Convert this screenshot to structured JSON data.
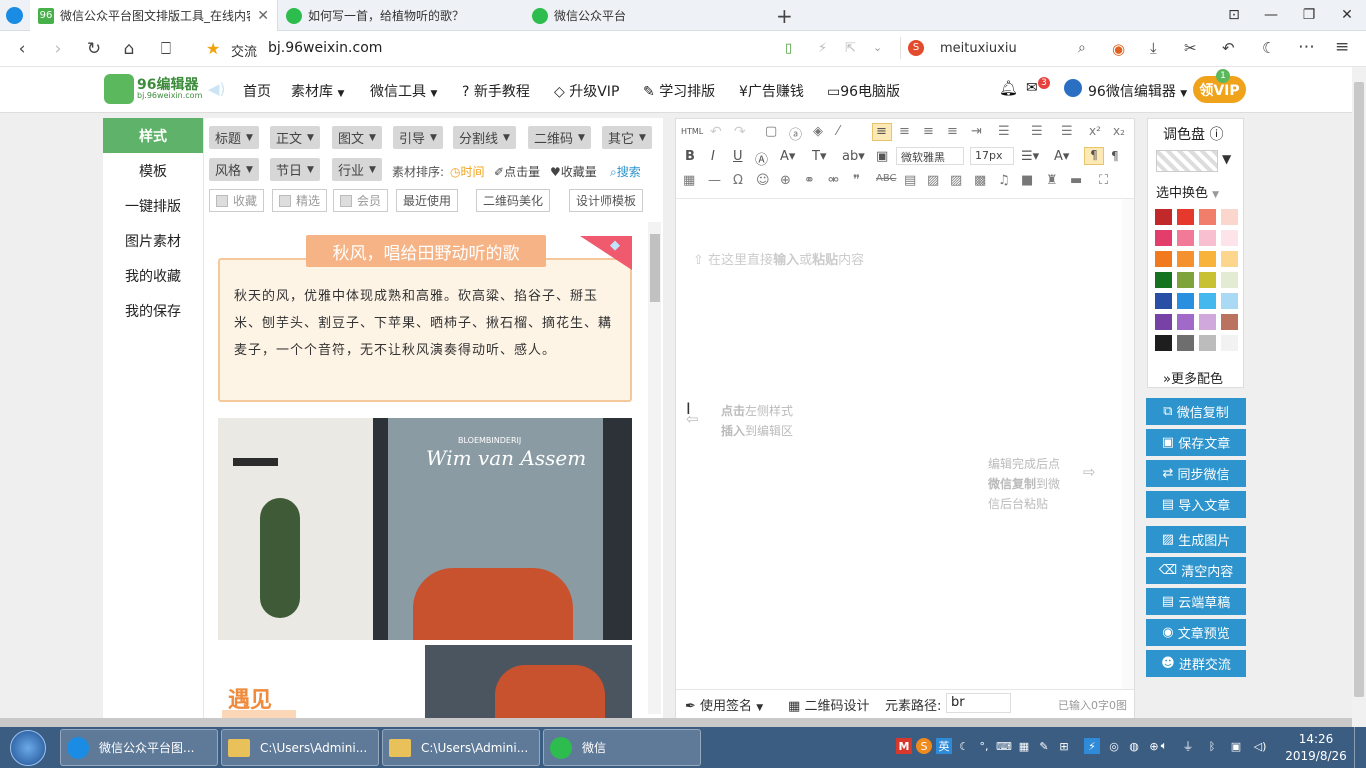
{
  "browser": {
    "tabs": [
      {
        "badge": "96",
        "title": "微信公众平台图文排版工具_在线内容"
      },
      {
        "title": "如何写一首，给植物听的歌？"
      },
      {
        "title": "微信公众平台"
      }
    ],
    "new_tab": "+",
    "bookmark_label": "交流",
    "url": "bj.96weixin.com",
    "search_value": "meituxiuxiu"
  },
  "site": {
    "logo_title": "96编辑器",
    "logo_sub": "bj.96weixin.com",
    "nav": [
      "首页",
      "素材库",
      "微信工具",
      "新手教程",
      "升级VIP",
      "学习排版",
      "广告赚钱",
      "96电脑版"
    ],
    "mail_count": "3",
    "account": "96微信编辑器",
    "vip_button": "领VIP",
    "vip_corner": "1"
  },
  "left_menu": [
    "样式",
    "模板",
    "一键排版",
    "图片素材",
    "我的收藏",
    "我的保存"
  ],
  "filters": {
    "row1": [
      "标题",
      "正文",
      "图文",
      "引导",
      "分割线",
      "二维码",
      "其它"
    ],
    "row2": [
      "风格",
      "节日",
      "行业"
    ],
    "sort_label": "素材排序:",
    "sort_options": [
      "时间",
      "点击量",
      "收藏量"
    ],
    "search": "搜索",
    "checks": [
      "收藏",
      "精选",
      "会员"
    ],
    "buttons": [
      "最近使用",
      "二维码美化",
      "设计师模板"
    ]
  },
  "preview": {
    "title": "秋风，唱给田野动听的歌",
    "body": "秋天的风，优雅中体现成熟和高雅。砍高粱、掐谷子、掰玉米、刨芋头、割豆子、下苹果、晒柿子、揪石榴、摘花生、耩麦子，一个个音符，无不让秋风演奏得动听、感人。",
    "shop_sign": "Wim van Assem",
    "shop_sign_small": "BLOEMBINDERIJ",
    "heading": "遇见"
  },
  "editor": {
    "html_label": "HTML",
    "font": "微软雅黑",
    "size": "17px",
    "hint_prefix": "在这里直接",
    "hint_bold1": "输入",
    "hint_mid": "或",
    "hint_bold2": "粘贴",
    "hint_suffix": "内容",
    "left_hint_b1": "点击",
    "left_hint_1": "左侧样式",
    "left_hint_b2": "插入",
    "left_hint_2": "到编辑区",
    "right_hint_1": "编辑完成后点",
    "right_hint_b": "微信复制",
    "right_hint_2": "到微",
    "right_hint_3": "信后台粘贴",
    "signature": "使用签名",
    "qrcode": "二维码设计",
    "path_label": "元素路径:",
    "path_value": "br",
    "count": "已输入0字0图"
  },
  "palette": {
    "title": "调色盘",
    "select_label": "选中换色",
    "more": "更多配色",
    "colors": [
      "#c0282a",
      "#e6392e",
      "#f07e6a",
      "#fbd6cc",
      "#e33d6b",
      "#f27a99",
      "#f7bfcf",
      "#fde3ea",
      "#f07a1d",
      "#f6912f",
      "#f8b33a",
      "#fbd68c",
      "#15731f",
      "#7ea33b",
      "#c8c233",
      "#e4ebd3",
      "#284ea6",
      "#2b8fe0",
      "#45b8ee",
      "#a9d9f5",
      "#7841a5",
      "#a26ac8",
      "#d1a8dc",
      "#b9735f",
      "#1e1e1e",
      "#6e6e6e",
      "#bcbcbc",
      "#f2f2f2"
    ]
  },
  "actions": [
    "微信复制",
    "保存文章",
    "同步微信",
    "导入文章",
    "生成图片",
    "清空内容",
    "云端草稿",
    "文章预览",
    "进群交流"
  ],
  "taskbar": {
    "windows": [
      "微信公众平台图...",
      "C:\\Users\\Admini...",
      "C:\\Users\\Admini...",
      "微信"
    ],
    "time": "14:26",
    "date": "2019/8/26",
    "ime": "英"
  }
}
